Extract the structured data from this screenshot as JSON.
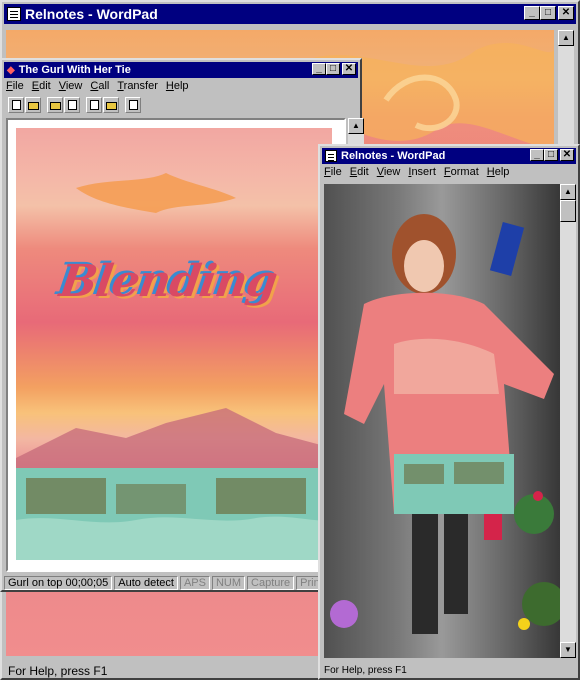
{
  "back_window": {
    "title": "Relnotes - WordPad",
    "status": "For Help, press F1"
  },
  "terminal_window": {
    "title": "The Gurl With Her Tie",
    "menu": [
      "File",
      "Edit",
      "View",
      "Call",
      "Transfer",
      "Help"
    ],
    "artwork_text": "Blending",
    "status": [
      "Gurl on top 00;00;05",
      "Auto detect",
      "APS",
      "NUM",
      "Capture",
      "Print echo"
    ]
  },
  "front_window": {
    "title": "Relnotes - WordPad",
    "menu": [
      "File",
      "Edit",
      "View",
      "Insert",
      "Format",
      "Help"
    ],
    "status": "For Help, press F1"
  },
  "colors": {
    "titlebar": "#000080",
    "chrome": "#c0c0c0",
    "sky_pink": "#e86a78",
    "sky_orange": "#f5a05a",
    "buildings_teal": "#7fc9b6"
  },
  "icons": [
    "new-file-icon",
    "open-folder-icon",
    "open-icon",
    "save-icon",
    "copy-icon",
    "paste-icon",
    "properties-icon"
  ]
}
